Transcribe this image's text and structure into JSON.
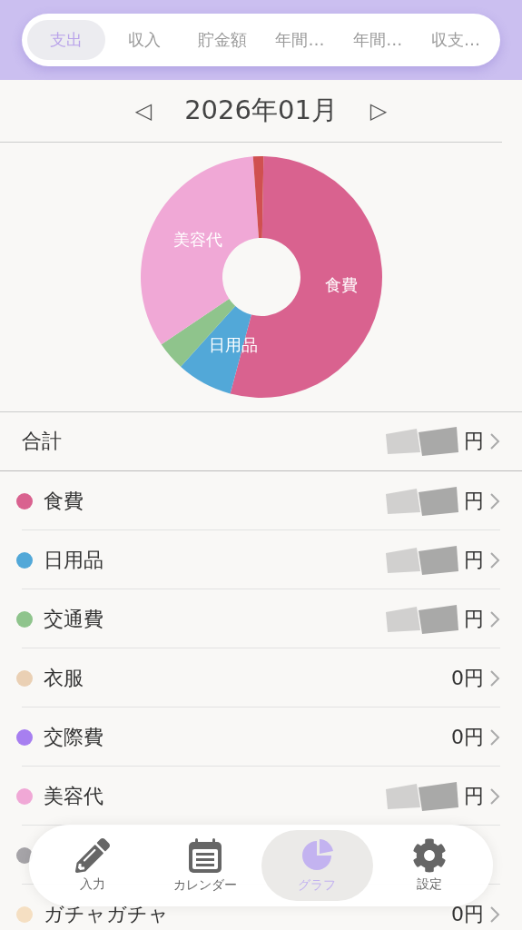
{
  "tabs": [
    {
      "label": "支出",
      "selected": true
    },
    {
      "label": "収入",
      "selected": false
    },
    {
      "label": "貯金額",
      "selected": false
    },
    {
      "label": "年間…",
      "selected": false
    },
    {
      "label": "年間…",
      "selected": false
    },
    {
      "label": "収支…",
      "selected": false
    }
  ],
  "month": {
    "prev": "◁",
    "label": "2026年01月",
    "next": "▷"
  },
  "pie_labels": [
    "美容代",
    "食費",
    "日用品"
  ],
  "total": {
    "label": "合計",
    "amount": "円",
    "redacted": true
  },
  "categories": [
    {
      "name": "食費",
      "color": "#d9628f",
      "amount": "円",
      "redacted": true
    },
    {
      "name": "日用品",
      "color": "#52a8d8",
      "amount": "円",
      "redacted": true
    },
    {
      "name": "交通費",
      "color": "#8fc48c",
      "amount": "円",
      "redacted": true
    },
    {
      "name": "衣服",
      "color": "#ead0b4",
      "amount": "0円",
      "redacted": false
    },
    {
      "name": "交際費",
      "color": "#a77ff0",
      "amount": "0円",
      "redacted": false
    },
    {
      "name": "美容代",
      "color": "#f0a8d6",
      "amount": "円",
      "redacted": true
    },
    {
      "color": "#a6a4a8",
      "redacted": false
    },
    {
      "name": "ガチャガチャ",
      "color": "#f5dfc2",
      "amount": "0円",
      "redacted": false
    }
  ],
  "nav": [
    {
      "kind": "pencil",
      "label": "入力",
      "selected": false
    },
    {
      "kind": "calendar",
      "label": "カレンダー",
      "selected": false
    },
    {
      "kind": "pie",
      "label": "グラフ",
      "selected": true
    },
    {
      "kind": "gear",
      "label": "設定",
      "selected": false
    }
  ]
}
